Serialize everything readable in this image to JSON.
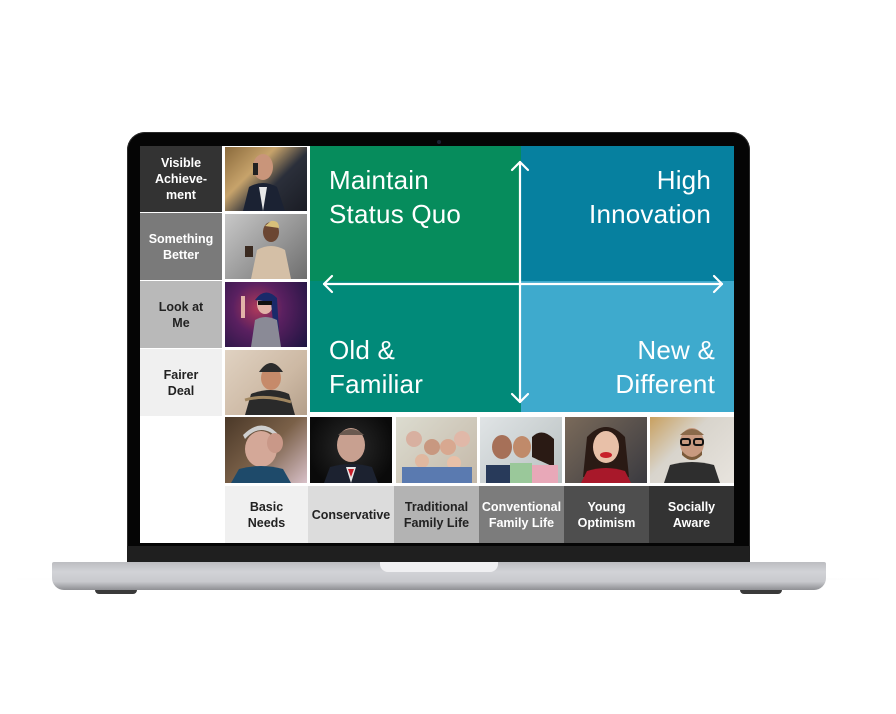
{
  "device": "laptop-mockup",
  "left_segments": [
    {
      "label": "Visible Achieve-ment",
      "lines": [
        "Visible",
        "Achieve-",
        "ment"
      ],
      "bg": "#333333",
      "fg": "#ffffff",
      "photo": "man-in-suit-on-phone"
    },
    {
      "label": "Something Better",
      "lines": [
        "Something",
        "Better"
      ],
      "bg": "#7a7a7a",
      "fg": "#ffffff",
      "photo": "woman-with-coffee"
    },
    {
      "label": "Look at Me",
      "lines": [
        "Look at",
        "Me"
      ],
      "bg": "#b9b9b9",
      "fg": "#222222",
      "photo": "woman-with-sunglasses-at-concert"
    },
    {
      "label": "Fairer Deal",
      "lines": [
        "Fairer",
        "Deal"
      ],
      "bg": "#f0f0f0",
      "fg": "#222222",
      "photo": "man-in-beanie"
    }
  ],
  "quadrants": {
    "top_left": {
      "lines": [
        "Maintain",
        "Status Quo"
      ],
      "color": "#068c5c"
    },
    "top_right": {
      "lines": [
        "High",
        "Innovation"
      ],
      "color": "#06809f"
    },
    "bottom_left": {
      "lines": [
        "Old &",
        "Familiar"
      ],
      "color": "#018a79"
    },
    "bottom_right": {
      "lines": [
        "New &",
        "Different"
      ],
      "color": "#3eaacd"
    }
  },
  "bottom_segments": [
    {
      "label": "Basic Needs",
      "lines": [
        "Basic",
        "Needs"
      ],
      "bg": "#f0f0f0",
      "fg": "#222222",
      "photo": "elderly-woman-distressed"
    },
    {
      "label": "Conservative",
      "lines": [
        "Conservative"
      ],
      "bg": "#dcdcdc",
      "fg": "#222222",
      "photo": "serious-man-in-suit"
    },
    {
      "label": "Traditional Family Life",
      "lines": [
        "Traditional",
        "Family Life"
      ],
      "bg": "#b3b3b3",
      "fg": "#222222",
      "photo": "multigenerational-family"
    },
    {
      "label": "Conventional Family Life",
      "lines": [
        "Conventional",
        "Family Life"
      ],
      "bg": "#7c7c7c",
      "fg": "#ffffff",
      "photo": "young-family-smiling"
    },
    {
      "label": "Young Optimism",
      "lines": [
        "Young",
        "Optimism"
      ],
      "bg": "#4e4e4e",
      "fg": "#ffffff",
      "photo": "laughing-young-woman"
    },
    {
      "label": "Socially Aware",
      "lines": [
        "Socially",
        "Aware"
      ],
      "bg": "#333333",
      "fg": "#ffffff",
      "photo": "man-with-glasses"
    }
  ]
}
